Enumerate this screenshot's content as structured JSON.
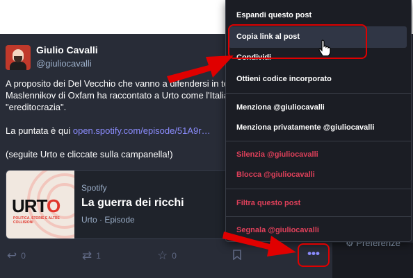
{
  "post": {
    "author_name": "Giulio Cavalli",
    "author_handle": "@giuliocavalli",
    "text_lines": [
      "A proposito dei Del Vecchio che vanno a difendersi in televis",
      "Maslennikov di Oxfam ha raccontato a Urto come l'Italia sia",
      "\"ereditocrazia\"."
    ],
    "episode_prefix": "La puntata è qui ",
    "episode_link": "open.spotify.com/episode/51A9r…",
    "closing_line": "(seguite Urto e cliccate sulla campanella!)",
    "card": {
      "provider": "Spotify",
      "title": "La guerra dei ricchi",
      "subtitle": "Urto · Episode",
      "logo_text": "URTO",
      "logo_tagline": "POLITICA, STORIE E ALTRE COLLISIONI"
    },
    "actions": {
      "reply_count": "0",
      "boost_count": "1",
      "favourite_count": "0",
      "more_label": "•••"
    }
  },
  "menu": {
    "items": [
      {
        "label": "Espandi questo post",
        "danger": false
      },
      {
        "label": "Copia link al post",
        "danger": false
      },
      {
        "label": "Condividi",
        "danger": false
      },
      {
        "label": "Ottieni codice incorporato",
        "danger": false
      },
      {
        "label": "Menziona @giuliocavalli",
        "danger": false
      },
      {
        "label": "Menziona privatamente @giuliocavalli",
        "danger": false
      },
      {
        "label": "Silenzia @giuliocavalli",
        "danger": true
      },
      {
        "label": "Blocca @giuliocavalli",
        "danger": true
      },
      {
        "label": "Filtra questo post",
        "danger": true
      },
      {
        "label": "Segnala @giuliocavalli",
        "danger": true
      }
    ]
  },
  "sidebar": {
    "preferences_label": "Preferenze"
  },
  "colors": {
    "accent": "#8c8dff",
    "danger": "#df405a",
    "annotation": "#e00000",
    "panel": "#282c37"
  }
}
